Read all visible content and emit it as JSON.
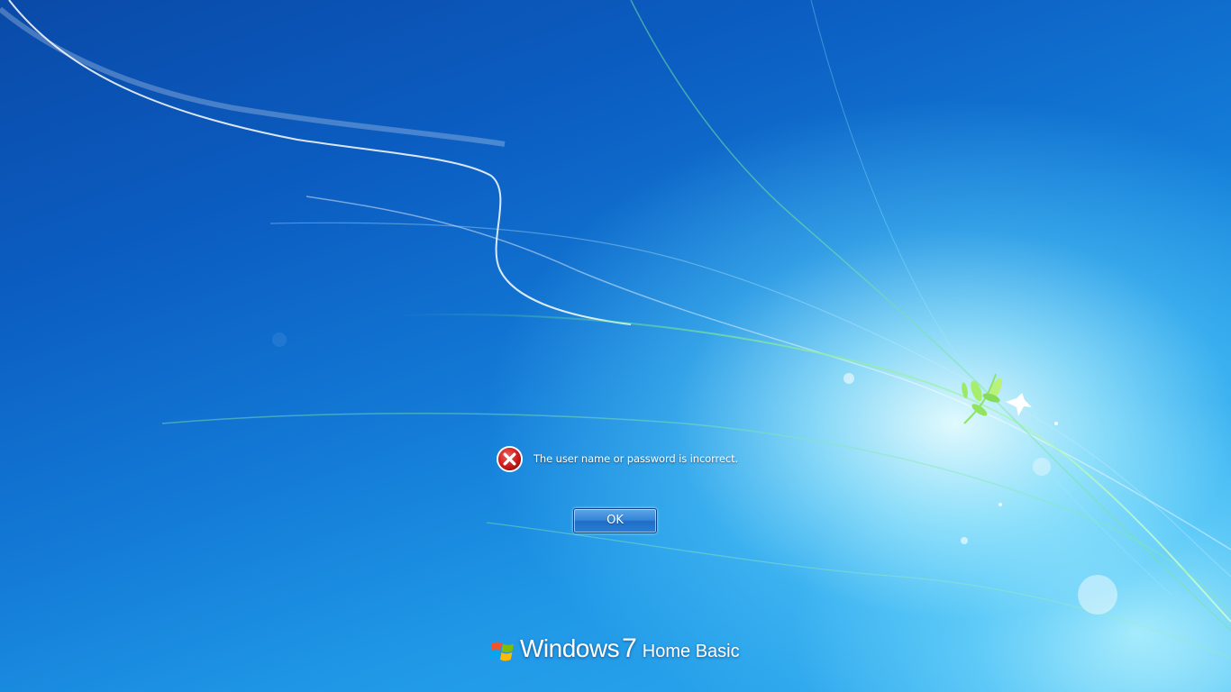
{
  "screen": {
    "type": "windows-logon-error"
  },
  "error_message": {
    "icon": "error-x-icon",
    "text": "The user name or password is incorrect."
  },
  "ok_button": {
    "label": "OK"
  },
  "branding": {
    "logo_icon": "windows-flag-icon",
    "windows": "Windows",
    "version": "7",
    "edition": "Home Basic"
  },
  "colors": {
    "background_dark": "#0a4aa8",
    "background_light": "#33aef0",
    "glow": "#eaffff",
    "error_red": "#d42020",
    "button_blue": "#2a7cd2"
  }
}
